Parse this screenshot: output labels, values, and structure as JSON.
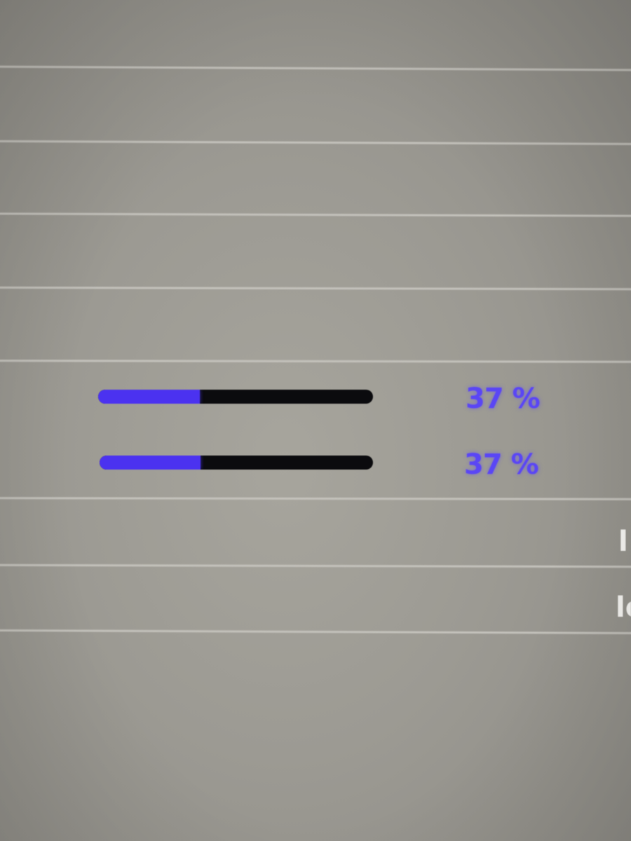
{
  "progress_rows": [
    {
      "value_percent": 37,
      "label": "37 %"
    },
    {
      "value_percent": 37,
      "label": "37 %"
    }
  ],
  "edge_labels": [
    "l",
    "lo"
  ],
  "colors": {
    "progress_fill": "#4b32f0",
    "progress_track": "#0b0b0e",
    "percent_text": "#5a46f5",
    "background": "#a7a59d",
    "divider": "#c8c6c0",
    "edge_label_text": "#f4f3f0"
  }
}
